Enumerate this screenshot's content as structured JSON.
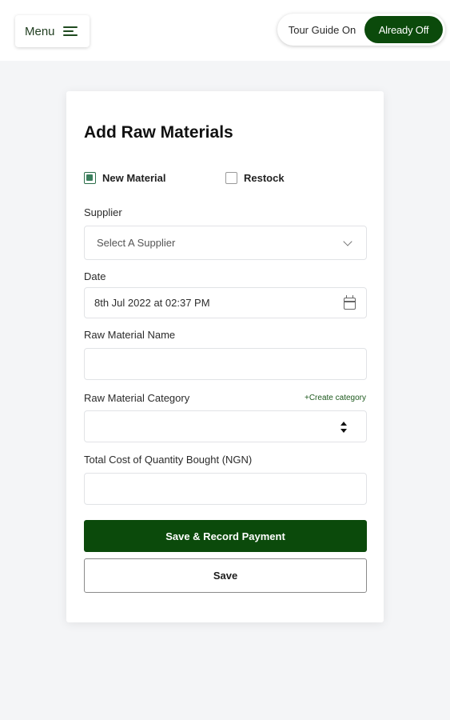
{
  "header": {
    "menu_label": "Menu",
    "tour_guide_on": "Tour Guide On",
    "tour_guide_off": "Already Off"
  },
  "form": {
    "title": "Add Raw Materials",
    "options": [
      {
        "label": "New Material",
        "checked": true
      },
      {
        "label": "Restock",
        "checked": false
      }
    ],
    "supplier": {
      "label": "Supplier",
      "placeholder": "Select A Supplier"
    },
    "date": {
      "label": "Date",
      "value": "8th Jul 2022 at 02:37 PM"
    },
    "name": {
      "label": "Raw Material Name",
      "value": ""
    },
    "category": {
      "label": "Raw Material Category",
      "create_link": "+Create category",
      "value": ""
    },
    "total_cost": {
      "label": "Total Cost of Quantity Bought (NGN)",
      "value": ""
    },
    "primary_button": "Save & Record Payment",
    "secondary_button": "Save"
  },
  "colors": {
    "brand_green": "#0b4a0b",
    "check_green": "#3b7f5d",
    "page_bg": "#f4f5f7"
  },
  "icons": [
    "hamburger-icon",
    "chevron-down-icon",
    "calendar-icon",
    "sort-arrows-icon"
  ]
}
